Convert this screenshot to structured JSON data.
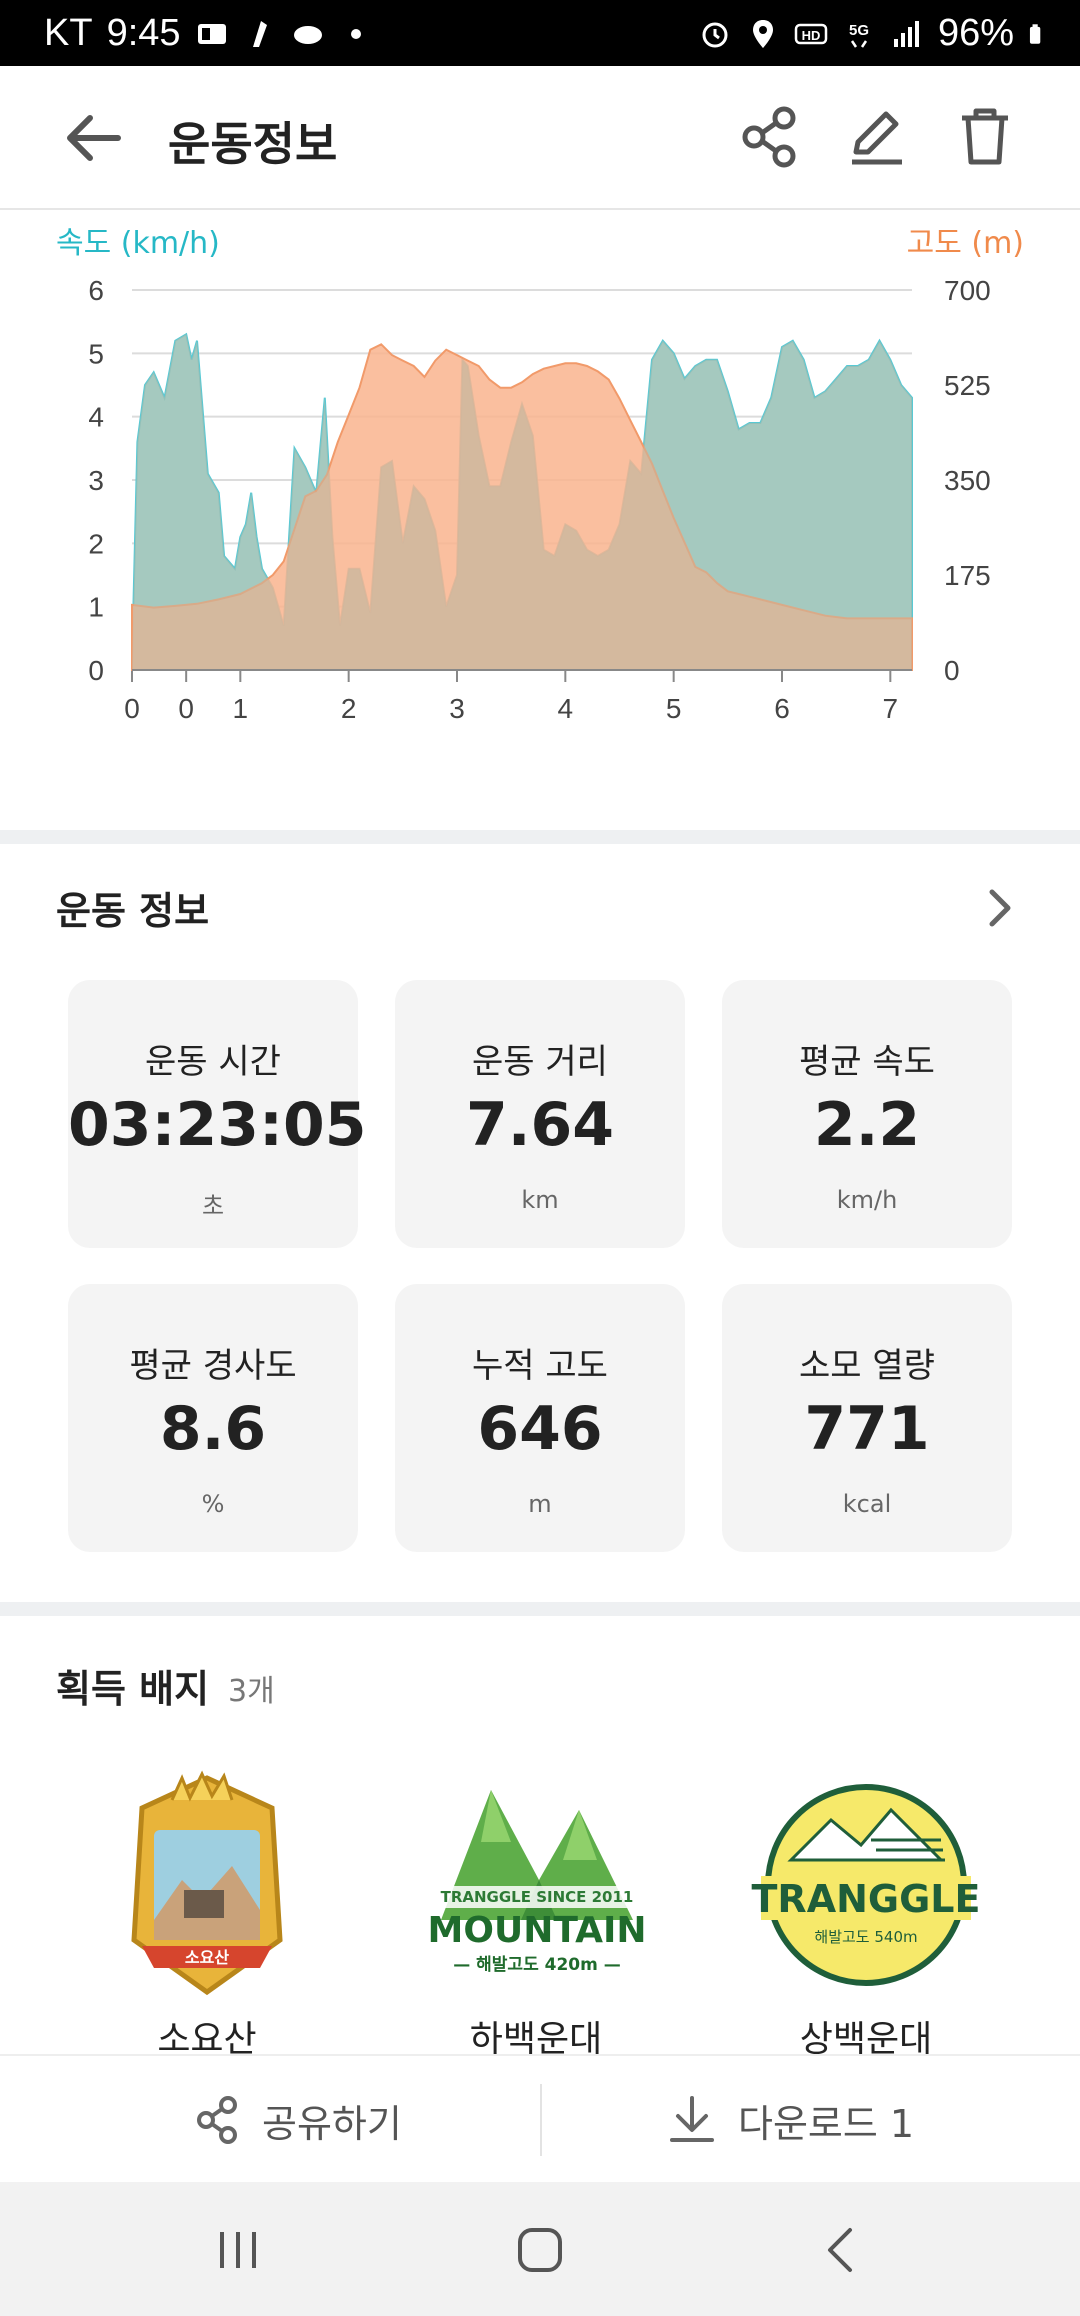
{
  "status_bar": {
    "carrier": "KT",
    "time": "9:45",
    "battery": "96%"
  },
  "app_bar": {
    "title": "운동정보"
  },
  "chart": {
    "left_axis_title": "속도 (km/h)",
    "right_axis_title": "고도 (m)",
    "colors": {
      "speed": "#7fdde4",
      "altitude": "#f9b48e",
      "overlap": "#c4b8a0"
    }
  },
  "chart_data": {
    "type": "area",
    "xlabel": "",
    "x_ticks": [
      "0",
      "0",
      "1",
      "2",
      "3",
      "4",
      "5",
      "6",
      "7"
    ],
    "y_left_ticks": [
      "6",
      "5",
      "4",
      "3",
      "2",
      "1",
      "0"
    ],
    "y_right_ticks": [
      "700",
      "525",
      "350",
      "175",
      "0"
    ],
    "ylim_left": [
      0,
      6
    ],
    "ylim_right": [
      0,
      700
    ],
    "grid": true,
    "series": [
      {
        "axis": "left",
        "x": [
          0,
          0.05,
          0.12,
          0.2,
          0.3,
          0.4,
          0.5,
          0.55,
          0.6,
          0.7,
          0.8,
          0.85,
          0.95,
          1.0,
          1.05,
          1.1,
          1.15,
          1.2,
          1.3,
          1.4,
          1.5,
          1.6,
          1.7,
          1.78,
          1.85,
          1.92,
          2.0,
          2.1,
          2.2,
          2.3,
          2.4,
          2.5,
          2.6,
          2.7,
          2.8,
          2.9,
          3.0,
          3.05,
          3.1,
          3.2,
          3.3,
          3.4,
          3.5,
          3.6,
          3.7,
          3.8,
          3.9,
          4.0,
          4.1,
          4.2,
          4.3,
          4.4,
          4.5,
          4.6,
          4.7,
          4.8,
          4.9,
          5.0,
          5.1,
          5.2,
          5.3,
          5.4,
          5.5,
          5.6,
          5.7,
          5.8,
          5.9,
          6.0,
          6.1,
          6.2,
          6.3,
          6.4,
          6.5,
          6.6,
          6.7,
          6.8,
          6.9,
          7.0,
          7.1,
          7.2
        ],
        "values": [
          0.1,
          3.6,
          4.5,
          4.7,
          4.3,
          5.2,
          5.3,
          4.9,
          5.2,
          3.1,
          2.8,
          1.8,
          1.6,
          2.1,
          2.3,
          2.8,
          2.1,
          1.6,
          1.3,
          0.7,
          3.5,
          3.2,
          2.8,
          4.3,
          2.1,
          0.7,
          1.6,
          1.6,
          0.9,
          3.2,
          3.3,
          2.0,
          2.9,
          2.7,
          2.2,
          1.0,
          1.5,
          4.9,
          4.8,
          3.7,
          2.9,
          2.9,
          3.6,
          4.2,
          3.7,
          1.9,
          1.8,
          2.3,
          2.2,
          1.9,
          1.8,
          1.9,
          2.3,
          3.3,
          3.1,
          4.9,
          5.2,
          5.0,
          4.6,
          4.8,
          4.9,
          4.9,
          4.4,
          3.8,
          3.9,
          3.9,
          4.3,
          5.1,
          5.2,
          4.9,
          4.3,
          4.4,
          4.6,
          4.8,
          4.8,
          4.9,
          5.2,
          4.9,
          4.5,
          4.3
        ]
      },
      {
        "axis": "right",
        "x": [
          0,
          0.2,
          0.4,
          0.6,
          0.8,
          1.0,
          1.2,
          1.3,
          1.4,
          1.5,
          1.6,
          1.7,
          1.8,
          1.9,
          2.0,
          2.1,
          2.2,
          2.3,
          2.4,
          2.5,
          2.6,
          2.7,
          2.8,
          2.9,
          3.0,
          3.1,
          3.2,
          3.3,
          3.4,
          3.5,
          3.6,
          3.7,
          3.8,
          3.9,
          4.0,
          4.1,
          4.2,
          4.3,
          4.4,
          4.5,
          4.6,
          4.7,
          4.8,
          4.9,
          5.0,
          5.1,
          5.2,
          5.3,
          5.4,
          5.5,
          5.6,
          5.7,
          5.8,
          5.9,
          6.0,
          6.2,
          6.4,
          6.6,
          6.8,
          7.0,
          7.2
        ],
        "values": [
          120,
          115,
          118,
          122,
          130,
          140,
          160,
          175,
          200,
          260,
          320,
          330,
          360,
          420,
          470,
          520,
          590,
          600,
          580,
          570,
          560,
          540,
          570,
          590,
          580,
          570,
          560,
          535,
          520,
          520,
          530,
          545,
          555,
          560,
          565,
          565,
          560,
          550,
          535,
          500,
          460,
          420,
          380,
          330,
          280,
          235,
          190,
          180,
          160,
          145,
          140,
          135,
          130,
          125,
          120,
          110,
          100,
          95,
          95,
          95,
          95
        ]
      }
    ]
  },
  "info": {
    "title": "운동 정보",
    "cards": [
      {
        "label": "운동 시간",
        "value": "03:23:05",
        "unit": "초"
      },
      {
        "label": "운동 거리",
        "value": "7.64",
        "unit": "km"
      },
      {
        "label": "평균 속도",
        "value": "2.2",
        "unit": "km/h"
      },
      {
        "label": "평균 경사도",
        "value": "8.6",
        "unit": "%"
      },
      {
        "label": "누적 고도",
        "value": "646",
        "unit": "m"
      },
      {
        "label": "소모 열량",
        "value": "771",
        "unit": "kcal"
      }
    ]
  },
  "badges": {
    "title": "획득 배지",
    "count": "3개",
    "items": [
      {
        "name": "소요산",
        "emblem_text": "소요산"
      },
      {
        "name": "하백운대",
        "emblem_text": "TRANGGLE SINCE 2011",
        "emblem_main": "MOUNTAIN",
        "emblem_sub": "— 해발고도 420m —"
      },
      {
        "name": "상백운대",
        "emblem_main": "TRANGGLE",
        "emblem_sub": "해발고도 540m"
      }
    ]
  },
  "actions": {
    "share_label": "공유하기",
    "download_label": "다운로드 1"
  }
}
